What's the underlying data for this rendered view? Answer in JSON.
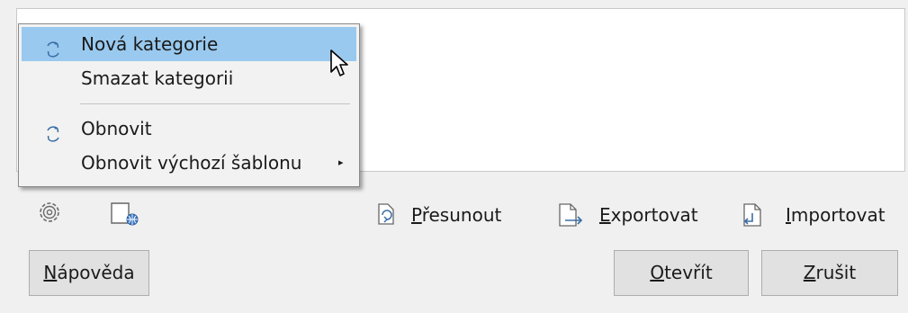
{
  "context_menu": {
    "items": [
      {
        "label": "Nová kategorie",
        "icon": "refresh-icon",
        "highlighted": true
      },
      {
        "label": "Smazat kategorii"
      },
      {
        "label": "Obnovit",
        "icon": "refresh-icon"
      },
      {
        "label": "Obnovit výchozí šablonu",
        "has_submenu": true
      }
    ],
    "submenu_arrow": "▸"
  },
  "toolbar": {
    "settings_icon": "gear-icon",
    "repository_icon": "globe-document-icon",
    "move": {
      "mnemonic": "P",
      "rest": "řesunout",
      "icon": "move-document-icon"
    },
    "export": {
      "mnemonic": "E",
      "rest": "xportovat",
      "icon": "export-document-icon"
    },
    "import": {
      "mnemonic": "I",
      "rest": "mportovat",
      "icon": "import-document-icon"
    }
  },
  "buttons": {
    "help": {
      "mnemonic": "N",
      "rest": "ápověda"
    },
    "open": {
      "mnemonic": "O",
      "rest": "tevřít"
    },
    "cancel": {
      "mnemonic": "Z",
      "rest": "rušit"
    }
  },
  "colors": {
    "menu_highlight": "#99c9ef",
    "icon_blue": "#3a6ea5"
  }
}
